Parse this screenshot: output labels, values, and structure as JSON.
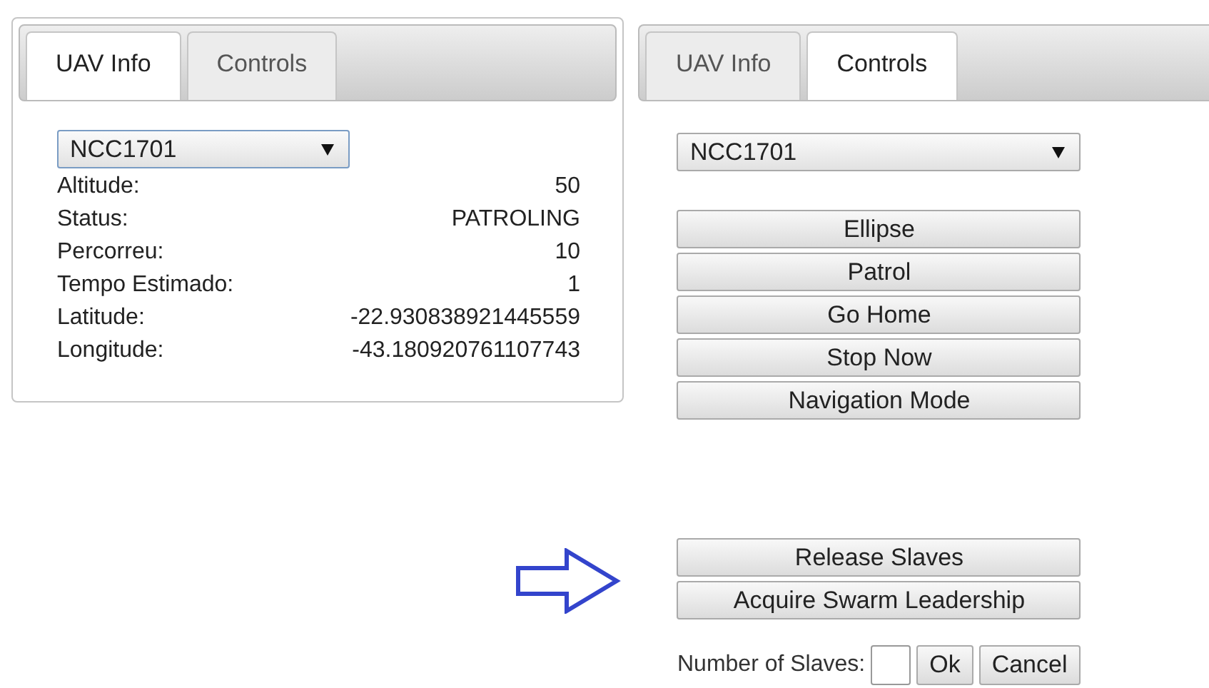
{
  "panels": [
    {
      "tabs": [
        {
          "label": "UAV Info",
          "selected": true
        },
        {
          "label": "Controls",
          "selected": false
        }
      ],
      "selector": {
        "value": "NCC1701"
      },
      "fields": [
        {
          "label": "Altitude:",
          "value": "50"
        },
        {
          "label": "Status:",
          "value": "PATROLING"
        },
        {
          "label": "Percorreu:",
          "value": "10"
        },
        {
          "label": "Tempo Estimado:",
          "value": "1"
        },
        {
          "label": "Latitude:",
          "value": "-22.930838921445559"
        },
        {
          "label": "Longitude:",
          "value": "-43.180920761107743"
        }
      ]
    },
    {
      "tabs": [
        {
          "label": "UAV Info",
          "selected": false
        },
        {
          "label": "Controls",
          "selected": true
        }
      ],
      "selector": {
        "value": "NCC1701"
      },
      "commands": [
        "Ellipse",
        "Patrol",
        "Go Home",
        "Stop Now",
        "Navigation Mode"
      ],
      "swarm_commands": [
        "Release Slaves",
        "Acquire Swarm Leadership"
      ],
      "slaves_prompt": {
        "label": "Number of Slaves:",
        "buttons": [
          "Ok",
          "Cancel"
        ]
      }
    }
  ]
}
